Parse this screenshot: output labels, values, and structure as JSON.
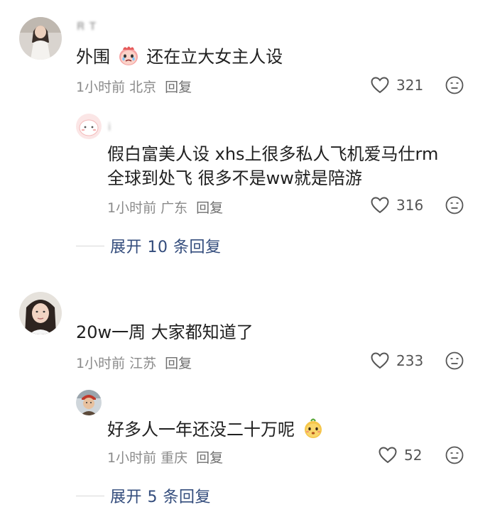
{
  "comments": [
    {
      "username": "𝐑 𝐓",
      "text_before": "外围",
      "text_after": "还在立大女主人设",
      "time": "1小时前",
      "location": "北京",
      "reply_label": "回复",
      "likes": "321",
      "reply": {
        "username": "i",
        "text_line1": "假白富美人设 xhs上很多私人飞机爱马仕rm",
        "text_line2": "全球到处飞 很多不是ww就是陪游",
        "time": "1小时前",
        "location": "广东",
        "reply_label": "回复",
        "likes": "316"
      },
      "expand_label": "展开 10 条回复"
    },
    {
      "username": "",
      "text": "20w一周 大家都知道了",
      "time": "1小时前",
      "location": "江苏",
      "reply_label": "回复",
      "likes": "233",
      "reply": {
        "username": "",
        "text": "好多人一年还没二十万呢",
        "time": "1小时前",
        "location": "重庆",
        "reply_label": "回复",
        "likes": "52"
      },
      "expand_label": "展开 5 条回复"
    }
  ],
  "colors": {
    "expand_link": "#334c7c",
    "meta_gray": "#8a8a8a"
  }
}
